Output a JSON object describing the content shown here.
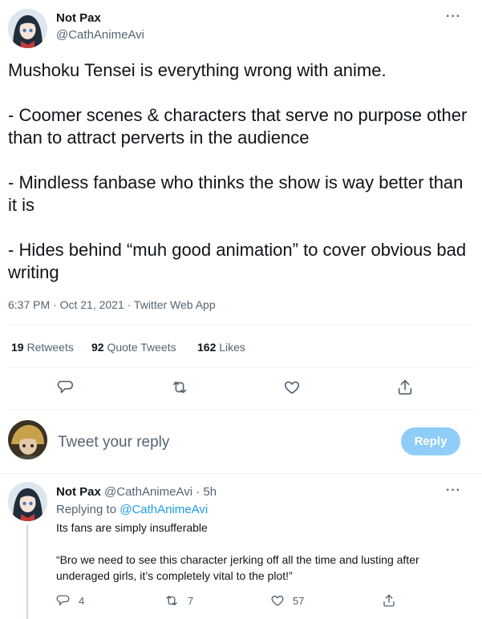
{
  "tweet": {
    "author_name": "Not Pax",
    "author_handle": "@CathAnimeAvi",
    "more_label": "···",
    "text": "Mushoku Tensei is everything wrong with anime.\n\n- Coomer scenes & characters that serve no purpose other than to attract perverts in the audience\n\n- Mindless fanbase who thinks the show is way better than it is\n\n- Hides behind “muh good animation” to cover obvious bad writing",
    "timestamp": "6:37 PM · Oct 21, 2021 · Twitter Web App",
    "stats": {
      "retweets_count": "19",
      "retweets_label": "Retweets",
      "quotes_count": "92",
      "quotes_label": "Quote Tweets",
      "likes_count": "162",
      "likes_label": "Likes"
    },
    "actions": {
      "reply_icon": "speech-bubble-icon",
      "retweet_icon": "retweet-icon",
      "like_icon": "heart-icon",
      "share_icon": "share-icon"
    }
  },
  "compose": {
    "placeholder": "Tweet your reply",
    "button_label": "Reply"
  },
  "reply": {
    "author_name": "Not Pax",
    "author_handle_time": "@CathAnimeAvi · 5h",
    "more_label": "···",
    "replying_prefix": "Replying to",
    "replying_to": "@CathAnimeAvi",
    "text": "Its fans are simply insufferable\n\n“Bro we need to see this character jerking off all the time and lusting after underaged girls, it’s completely vital to the plot!”",
    "reply_count": "4",
    "retweet_count": "7",
    "like_count": "57"
  },
  "colors": {
    "accent": "#1d9bf0",
    "reply_button": "#8ecdf8",
    "muted_text": "#536471",
    "divider": "#eff3f4"
  }
}
